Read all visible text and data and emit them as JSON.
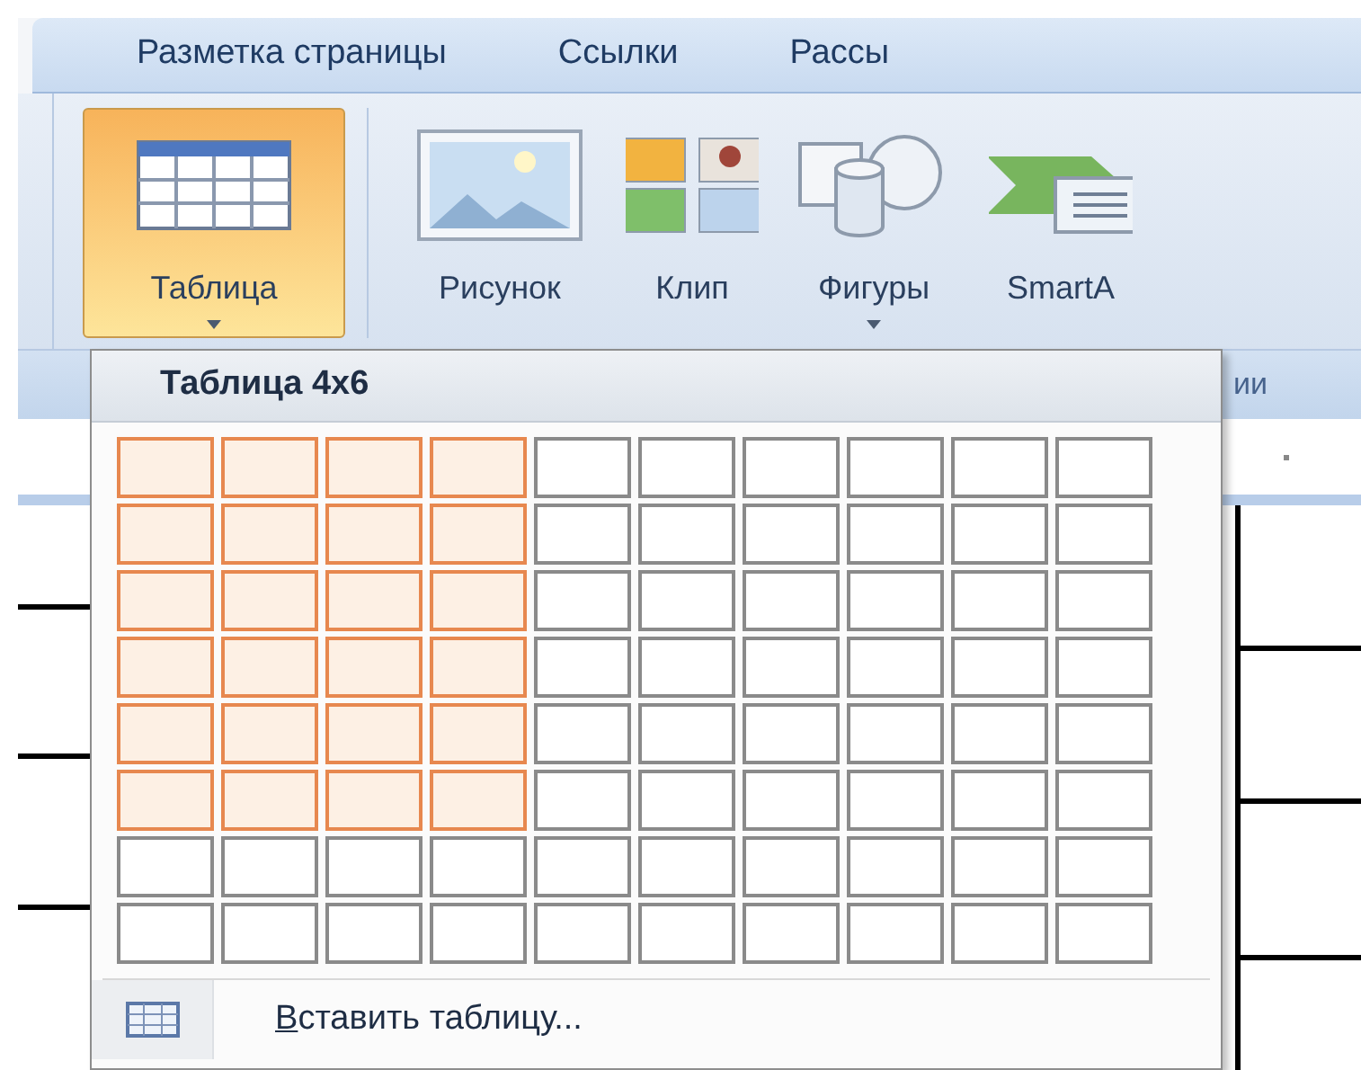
{
  "tabs": [
    {
      "label": "Разметка страницы"
    },
    {
      "label": "Ссылки"
    },
    {
      "label": "Рассы"
    }
  ],
  "ribbon": {
    "buttons": [
      {
        "label": "Таблица",
        "kind": "table",
        "selected": true,
        "dropdown": true
      },
      {
        "label": "Рисунок",
        "kind": "picture",
        "selected": false,
        "dropdown": false
      },
      {
        "label": "Клип",
        "kind": "clip",
        "selected": false,
        "dropdown": false
      },
      {
        "label": "Фигуры",
        "kind": "shapes",
        "selected": false,
        "dropdown": true
      },
      {
        "label": "SmartA",
        "kind": "smartart",
        "selected": false,
        "dropdown": false
      }
    ],
    "group_label": "ии"
  },
  "table_menu": {
    "title": "Таблица 4x6",
    "grid": [
      {
        "cells": [
          {
            "selected": true
          },
          {
            "selected": true
          },
          {
            "selected": true
          },
          {
            "selected": true
          },
          {
            "selected": false
          },
          {
            "selected": false
          },
          {
            "selected": false
          },
          {
            "selected": false
          },
          {
            "selected": false
          },
          {
            "selected": false
          }
        ]
      },
      {
        "cells": [
          {
            "selected": true
          },
          {
            "selected": true
          },
          {
            "selected": true
          },
          {
            "selected": true
          },
          {
            "selected": false
          },
          {
            "selected": false
          },
          {
            "selected": false
          },
          {
            "selected": false
          },
          {
            "selected": false
          },
          {
            "selected": false
          }
        ]
      },
      {
        "cells": [
          {
            "selected": true
          },
          {
            "selected": true
          },
          {
            "selected": true
          },
          {
            "selected": true
          },
          {
            "selected": false
          },
          {
            "selected": false
          },
          {
            "selected": false
          },
          {
            "selected": false
          },
          {
            "selected": false
          },
          {
            "selected": false
          }
        ]
      },
      {
        "cells": [
          {
            "selected": true
          },
          {
            "selected": true
          },
          {
            "selected": true
          },
          {
            "selected": true
          },
          {
            "selected": false
          },
          {
            "selected": false
          },
          {
            "selected": false
          },
          {
            "selected": false
          },
          {
            "selected": false
          },
          {
            "selected": false
          }
        ]
      },
      {
        "cells": [
          {
            "selected": true
          },
          {
            "selected": true
          },
          {
            "selected": true
          },
          {
            "selected": true
          },
          {
            "selected": false
          },
          {
            "selected": false
          },
          {
            "selected": false
          },
          {
            "selected": false
          },
          {
            "selected": false
          },
          {
            "selected": false
          }
        ]
      },
      {
        "cells": [
          {
            "selected": true
          },
          {
            "selected": true
          },
          {
            "selected": true
          },
          {
            "selected": true
          },
          {
            "selected": false
          },
          {
            "selected": false
          },
          {
            "selected": false
          },
          {
            "selected": false
          },
          {
            "selected": false
          },
          {
            "selected": false
          }
        ]
      },
      {
        "cells": [
          {
            "selected": false
          },
          {
            "selected": false
          },
          {
            "selected": false
          },
          {
            "selected": false
          },
          {
            "selected": false
          },
          {
            "selected": false
          },
          {
            "selected": false
          },
          {
            "selected": false
          },
          {
            "selected": false
          },
          {
            "selected": false
          }
        ]
      },
      {
        "cells": [
          {
            "selected": false
          },
          {
            "selected": false
          },
          {
            "selected": false
          },
          {
            "selected": false
          },
          {
            "selected": false
          },
          {
            "selected": false
          },
          {
            "selected": false
          },
          {
            "selected": false
          },
          {
            "selected": false
          },
          {
            "selected": false
          }
        ]
      }
    ],
    "items": [
      {
        "label": "Вставить таблицу..."
      }
    ]
  }
}
